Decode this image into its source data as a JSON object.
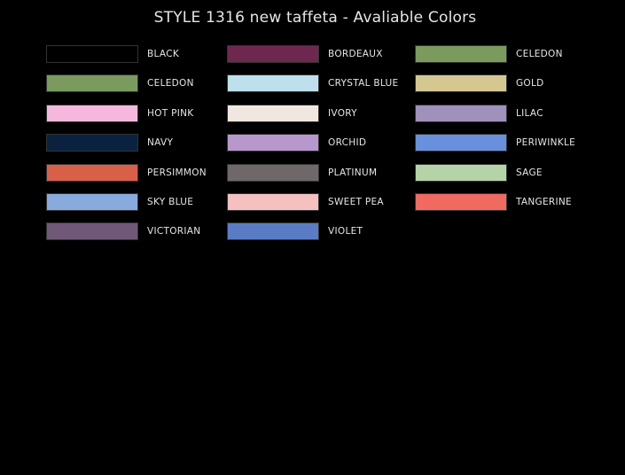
{
  "title": "STYLE 1316 new taffeta - Avaliable Colors",
  "columns": [
    {
      "items": [
        {
          "label": "BLACK",
          "color": "#000000"
        },
        {
          "label": "CELEDON",
          "color": "#7a9a5e"
        },
        {
          "label": "HOT PINK",
          "color": "#f5b8dc"
        },
        {
          "label": "NAVY",
          "color": "#0a2240"
        },
        {
          "label": "PERSIMMON",
          "color": "#d95f48"
        },
        {
          "label": "SKY BLUE",
          "color": "#88aadc"
        },
        {
          "label": "VICTORIAN",
          "color": "#705878"
        }
      ]
    },
    {
      "items": [
        {
          "label": "BORDEAUX",
          "color": "#6e2850"
        },
        {
          "label": "CRYSTAL BLUE",
          "color": "#bde0ec"
        },
        {
          "label": "IVORY",
          "color": "#f0e8e0"
        },
        {
          "label": "ORCHID",
          "color": "#b898cc"
        },
        {
          "label": "PLATINUM",
          "color": "#706868"
        },
        {
          "label": "SWEET PEA",
          "color": "#f5c0c0"
        },
        {
          "label": "VIOLET",
          "color": "#5a7cc4"
        }
      ]
    },
    {
      "items": [
        {
          "label": "CELEDON",
          "color": "#7a9a5e"
        },
        {
          "label": "GOLD",
          "color": "#d4c890"
        },
        {
          "label": "LILAC",
          "color": "#a090bc"
        },
        {
          "label": "PERIWINKLE",
          "color": "#6890dc"
        },
        {
          "label": "SAGE",
          "color": "#b4d4a8"
        },
        {
          "label": "TANGERINE",
          "color": "#f06a60"
        }
      ]
    }
  ]
}
